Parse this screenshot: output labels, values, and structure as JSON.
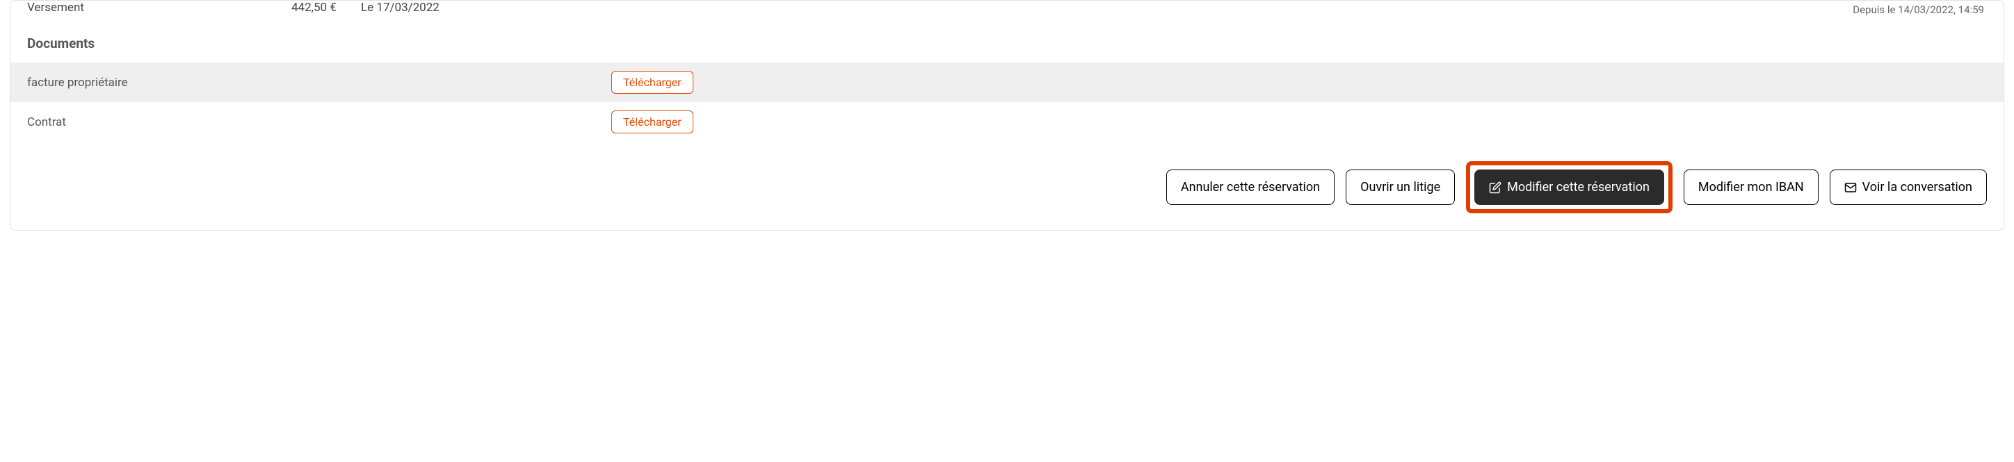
{
  "payment": {
    "label": "Versement",
    "amount": "442,50 €",
    "date": "Le 17/03/2022",
    "status": "Depuis le 14/03/2022, 14:59"
  },
  "documents": {
    "title": "Documents",
    "rows": [
      {
        "label": "facture propriétaire",
        "action": "Télécharger"
      },
      {
        "label": "Contrat",
        "action": "Télécharger"
      }
    ]
  },
  "actions": {
    "cancel": "Annuler cette réservation",
    "dispute": "Ouvrir un litige",
    "modify": "Modifier cette réservation",
    "iban": "Modifier mon IBAN",
    "conversation": "Voir la conversation"
  }
}
